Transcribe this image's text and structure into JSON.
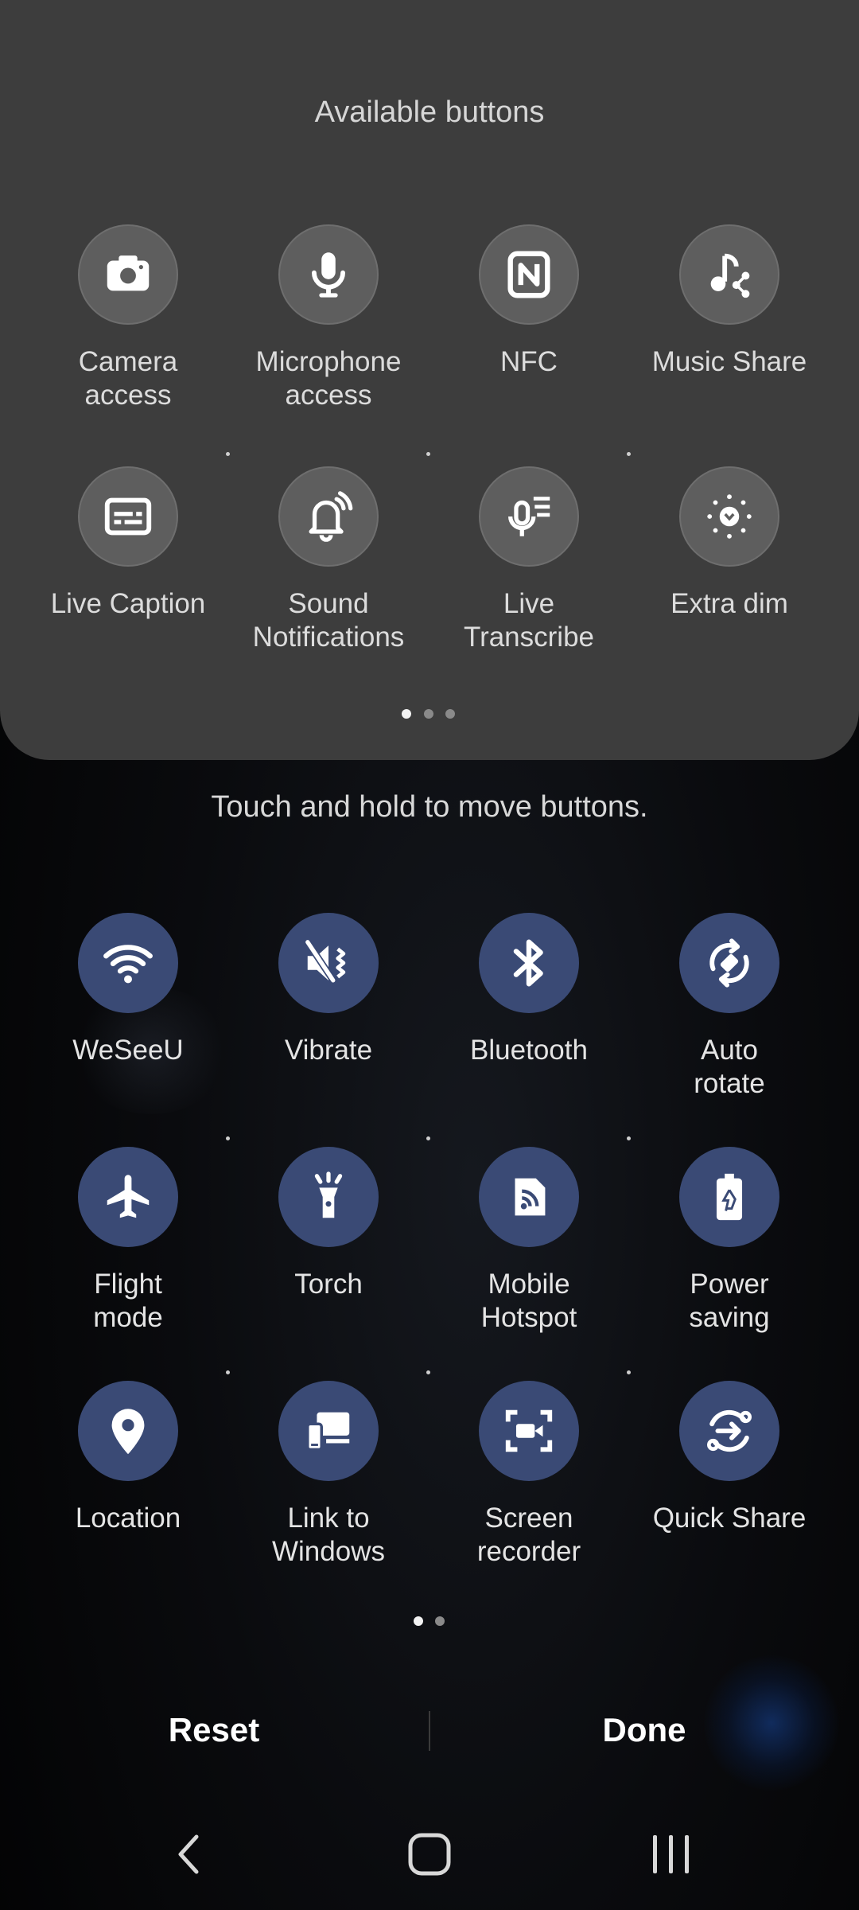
{
  "colors": {
    "available_tile": "#5e5e5e",
    "active_tile": "#3a4a75",
    "panel_background": "#3d3d3d",
    "background": "#000000"
  },
  "available_panel": {
    "title": "Available buttons",
    "tiles": [
      {
        "label": "Camera\naccess",
        "icon": "camera-icon"
      },
      {
        "label": "Microphone\naccess",
        "icon": "microphone-icon"
      },
      {
        "label": "NFC",
        "icon": "nfc-icon"
      },
      {
        "label": "Music Share",
        "icon": "music-share-icon"
      },
      {
        "label": "Live Caption",
        "icon": "live-caption-icon"
      },
      {
        "label": "Sound\nNotifications",
        "icon": "sound-notifications-icon"
      },
      {
        "label": "Live\nTranscribe",
        "icon": "live-transcribe-icon"
      },
      {
        "label": "Extra dim",
        "icon": "extra-dim-icon"
      }
    ],
    "page_count": 3,
    "current_page": 1
  },
  "hint": "Touch and hold to move buttons.",
  "active_panel": {
    "tiles": [
      {
        "label": "WeSeeU",
        "icon": "wifi-icon"
      },
      {
        "label": "Vibrate",
        "icon": "vibrate-icon"
      },
      {
        "label": "Bluetooth",
        "icon": "bluetooth-icon"
      },
      {
        "label": "Auto\nrotate",
        "icon": "auto-rotate-icon"
      },
      {
        "label": "Flight\nmode",
        "icon": "airplane-icon"
      },
      {
        "label": "Torch",
        "icon": "torch-icon"
      },
      {
        "label": "Mobile\nHotspot",
        "icon": "hotspot-icon"
      },
      {
        "label": "Power\nsaving",
        "icon": "power-saving-icon"
      },
      {
        "label": "Location",
        "icon": "location-icon"
      },
      {
        "label": "Link to\nWindows",
        "icon": "link-to-windows-icon"
      },
      {
        "label": "Screen\nrecorder",
        "icon": "screen-recorder-icon"
      },
      {
        "label": "Quick Share",
        "icon": "quick-share-icon"
      }
    ],
    "page_count": 2,
    "current_page": 1
  },
  "actions": {
    "reset": "Reset",
    "done": "Done"
  },
  "navigation": {
    "back": "back-icon",
    "home": "home-icon",
    "recents": "recents-icon"
  }
}
